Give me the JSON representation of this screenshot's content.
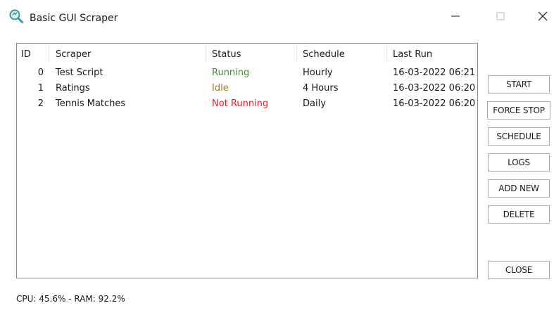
{
  "window": {
    "title": "Basic GUI Scraper",
    "icon": "magnifier-icon",
    "controls": [
      "minimize-icon",
      "maximize-icon",
      "close-icon"
    ]
  },
  "table": {
    "columns": [
      "ID",
      "Scraper",
      "Status",
      "Schedule",
      "Last Run"
    ],
    "rows": [
      {
        "id": "0",
        "scraper": "Test Script",
        "status": "Running",
        "schedule": "Hourly",
        "last_run": "16-03-2022 06:21"
      },
      {
        "id": "1",
        "scraper": "Ratings",
        "status": "Idle",
        "schedule": "4 Hours",
        "last_run": "16-03-2022 06:20"
      },
      {
        "id": "2",
        "scraper": "Tennis Matches",
        "status": "Not Running",
        "schedule": "Daily",
        "last_run": "16-03-2022 06:20"
      }
    ]
  },
  "status_colors": {
    "Running": "#3f8f2c",
    "Idle": "#a07a28",
    "Not Running": "#e0202a"
  },
  "buttons": {
    "start": "START",
    "force_stop": "FORCE STOP",
    "schedule": "SCHEDULE",
    "logs": "LOGS",
    "add_new": "ADD NEW",
    "delete": "DELETE",
    "close": "CLOSE"
  },
  "footer": {
    "stats": "CPU: 45.6% - RAM: 92.2%"
  }
}
